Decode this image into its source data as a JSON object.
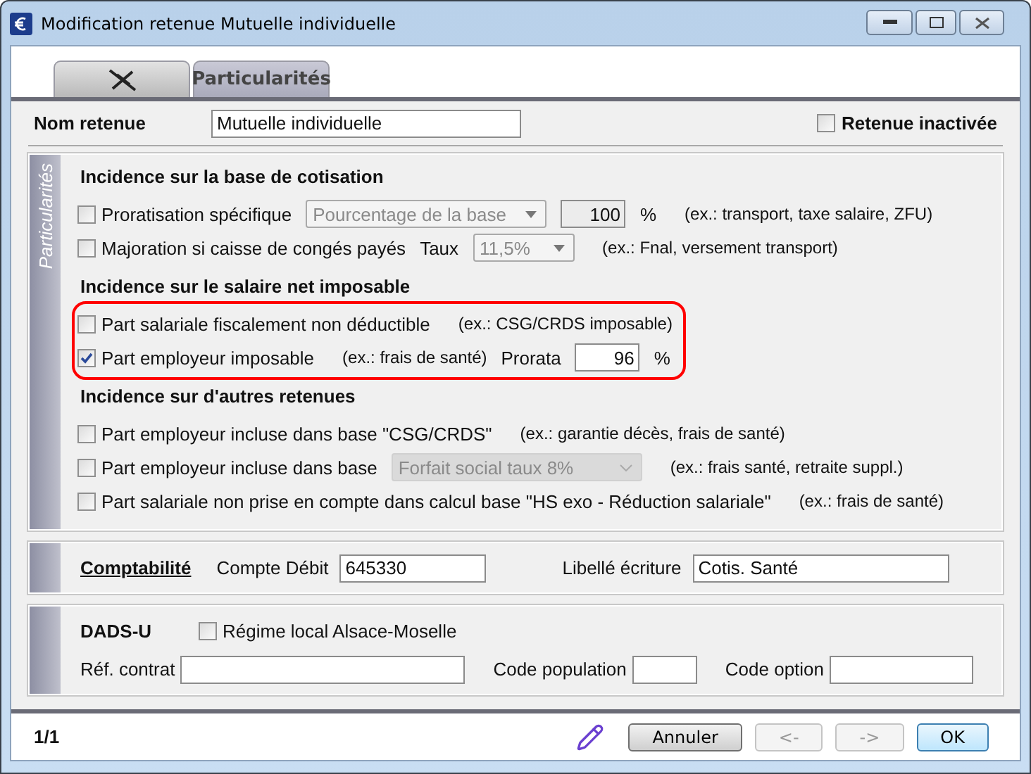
{
  "window": {
    "title": "Modification retenue Mutuelle individuelle"
  },
  "tabs": [
    {
      "kind": "icon",
      "selected": false
    },
    {
      "kind": "text",
      "label": "Particularités",
      "selected": true
    }
  ],
  "name_field": {
    "label": "Nom retenue",
    "value": "Mutuelle individuelle"
  },
  "inactive": {
    "label": "Retenue inactivée",
    "checked": false
  },
  "particularites": {
    "side_label": "Particularités",
    "sections": [
      {
        "title": "Incidence sur la base de cotisation",
        "highlighted": false,
        "rows": [
          {
            "items": [
              {
                "kind": "checkbox",
                "label": "Proratisation spécifique",
                "checked": false
              },
              {
                "kind": "select",
                "value": "Pourcentage de la base",
                "disabled": true
              },
              {
                "kind": "input",
                "value": "100",
                "disabled": true
              },
              {
                "kind": "text",
                "text": "%"
              },
              {
                "kind": "hint",
                "text": "(ex.: transport, taxe salaire, ZFU)"
              }
            ]
          },
          {
            "items": [
              {
                "kind": "checkbox",
                "label": "Majoration si caisse de congés payés",
                "checked": false
              },
              {
                "kind": "text",
                "text": "Taux"
              },
              {
                "kind": "select",
                "value": "11,5%",
                "disabled": true
              },
              {
                "kind": "hint",
                "text": "(ex.: Fnal, versement transport)"
              }
            ]
          }
        ]
      },
      {
        "title": "Incidence sur le salaire net imposable",
        "highlighted": true,
        "rows": [
          {
            "items": [
              {
                "kind": "checkbox",
                "label": "Part salariale fiscalement non déductible",
                "checked": false
              },
              {
                "kind": "hint",
                "text": "(ex.: CSG/CRDS imposable)"
              }
            ]
          },
          {
            "items": [
              {
                "kind": "checkbox",
                "label": "Part employeur imposable",
                "checked": true
              },
              {
                "kind": "hint",
                "text": "(ex.: frais de santé)"
              },
              {
                "kind": "text",
                "text": "Prorata"
              },
              {
                "kind": "input",
                "value": "96",
                "disabled": false
              },
              {
                "kind": "text",
                "text": "%"
              }
            ]
          }
        ]
      },
      {
        "title": "Incidence sur d'autres retenues",
        "highlighted": false,
        "rows": [
          {
            "items": [
              {
                "kind": "checkbox",
                "label": "Part employeur incluse dans base \"CSG/CRDS\"",
                "checked": false
              },
              {
                "kind": "hint",
                "text": "(ex.: garantie décès, frais de santé)"
              }
            ]
          },
          {
            "items": [
              {
                "kind": "checkbox",
                "label": "Part employeur incluse dans base",
                "checked": false
              },
              {
                "kind": "combo",
                "value": "Forfait social taux 8%",
                "disabled": true
              },
              {
                "kind": "hint",
                "text": "(ex.: frais santé, retraite suppl.)"
              }
            ]
          },
          {
            "items": [
              {
                "kind": "checkbox",
                "label": "Part salariale non prise en compte dans calcul base \"HS exo - Réduction salariale\"",
                "checked": false
              },
              {
                "kind": "hint",
                "text": "(ex.: frais de santé)"
              }
            ]
          }
        ]
      }
    ]
  },
  "comptabilite": {
    "title": "Comptabilité",
    "fields": [
      {
        "label": "Compte Débit",
        "value": "645330"
      },
      {
        "label": "Libellé écriture",
        "value": "Cotis. Santé"
      }
    ]
  },
  "dads": {
    "title": "DADS-U",
    "checkbox": {
      "label": "Régime local Alsace-Moselle",
      "checked": false
    },
    "fields": [
      {
        "label": "Réf. contrat"
      },
      {
        "label": "Code population"
      },
      {
        "label": "Code option"
      }
    ]
  },
  "footer": {
    "page": "1/1",
    "buttons": [
      {
        "label": "Annuler",
        "disabled": false,
        "default": false
      },
      {
        "label": "<-",
        "disabled": true,
        "default": false
      },
      {
        "label": "->",
        "disabled": true,
        "default": false
      },
      {
        "label": "OK",
        "disabled": false,
        "default": true
      }
    ]
  }
}
